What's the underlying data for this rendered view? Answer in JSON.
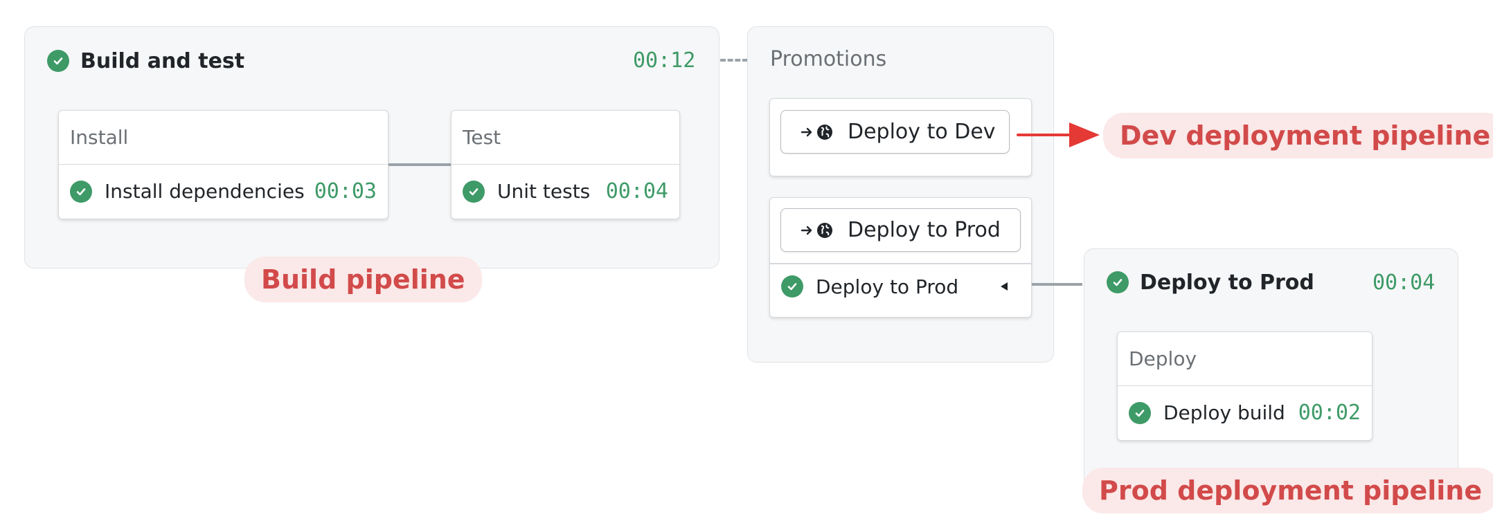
{
  "build_block": {
    "title": "Build and test",
    "duration": "00:12",
    "install_block": {
      "name": "Install",
      "job": "Install dependencies",
      "duration": "00:03"
    },
    "test_block": {
      "name": "Test",
      "job": "Unit tests",
      "duration": "00:04"
    }
  },
  "promotions": {
    "title": "Promotions",
    "deploy_dev_button": "Deploy to Dev",
    "deploy_prod_button": "Deploy to Prod",
    "deploy_prod_status": "Deploy to Prod"
  },
  "prod_block": {
    "title": "Deploy to Prod",
    "duration": "00:04",
    "deploy_block": {
      "name": "Deploy",
      "job": "Deploy build",
      "duration": "00:02"
    }
  },
  "callouts": {
    "build": "Build pipeline",
    "dev": "Dev deployment pipeline",
    "prod": "Prod deployment pipeline"
  },
  "colors": {
    "success": "#3e9a67",
    "callout_text": "#d24a4a",
    "callout_bg": "#fbe8e8",
    "arrow": "#e53935"
  },
  "icons": [
    "check-circle-icon",
    "arrow-right-icon",
    "globe-icon",
    "caret-left-icon"
  ]
}
